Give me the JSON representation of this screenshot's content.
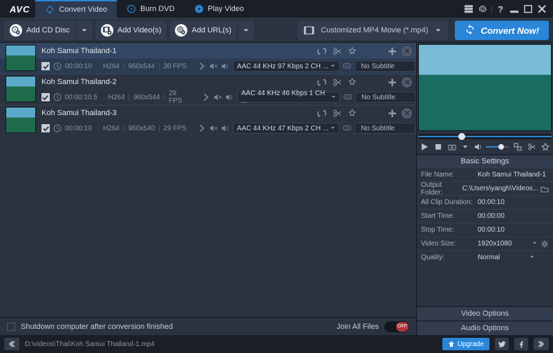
{
  "app": {
    "logo": "AVC"
  },
  "tabs": [
    {
      "label": "Convert Video"
    },
    {
      "label": "Burn DVD"
    },
    {
      "label": "Play Video"
    }
  ],
  "toolbar": {
    "add_cd": "Add CD Disc",
    "add_videos": "Add Video(s)",
    "add_urls": "Add URL(s)",
    "profile": "Customized MP4 Movie (*.mp4)",
    "convert": "Convert Now!"
  },
  "items": [
    {
      "title": "Koh Samui Thailand-1",
      "duration": "00:00:10",
      "codec": "H264",
      "res": "960x544",
      "fps": "30 FPS",
      "audio": "AAC 44 KHz 97 Kbps 2 CH ...",
      "subtitle": "No Subtitle",
      "selected": true
    },
    {
      "title": "Koh Samui Thailand-2",
      "duration": "00:00:10.5",
      "codec": "H264",
      "res": "960x544",
      "fps": "29 FPS",
      "audio": "AAC 44 KHz 46 Kbps 1 CH ...",
      "subtitle": "No Subtitle",
      "selected": false
    },
    {
      "title": "Koh Samui Thailand-3",
      "duration": "00:00:10",
      "codec": "H264",
      "res": "960x540",
      "fps": "29 FPS",
      "audio": "AAC 44 KHz 47 Kbps 2 CH ...",
      "subtitle": "No Subtitle",
      "selected": false
    }
  ],
  "listFooter": {
    "shutdown": "Shutdown computer after conversion finished",
    "joinAll": "Join All Files",
    "toggle": "OFF"
  },
  "side": {
    "basicTitle": "Basic Settings",
    "rows": {
      "fileName": {
        "label": "File Name:",
        "value": "Koh Samui Thailand-1"
      },
      "outputFolder": {
        "label": "Output Folder:",
        "value": "C:\\Users\\yangh\\Videos..."
      },
      "clipDuration": {
        "label": "All Clip Duration:",
        "value": "00:00:10"
      },
      "startTime": {
        "label": "Start Time:",
        "value": "00:00:00"
      },
      "stopTime": {
        "label": "Stop Time:",
        "value": "00:00:10"
      },
      "videoSize": {
        "label": "Video Size:",
        "value": "1920x1080"
      },
      "quality": {
        "label": "Quality:",
        "value": "Normal"
      }
    },
    "videoOptions": "Video Options",
    "audioOptions": "Audio Options"
  },
  "statusbar": {
    "path": "D:\\videos\\Thai\\Koh Samui Thailand-1.mp4",
    "upgrade": "Upgrade"
  }
}
